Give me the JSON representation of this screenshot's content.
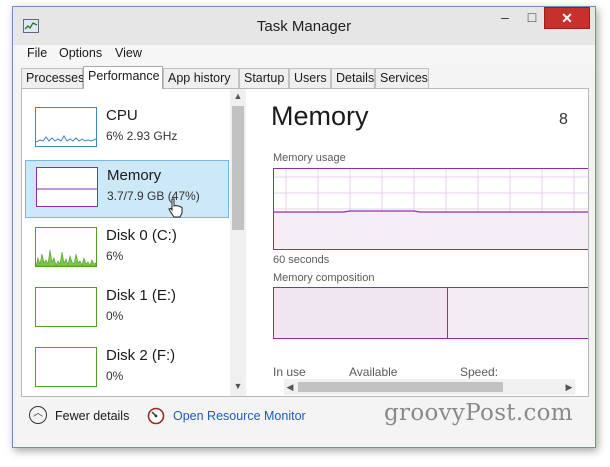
{
  "window": {
    "title": "Task Manager",
    "controls": {
      "minimize": "–",
      "maximize": "□",
      "close": "✕"
    }
  },
  "menu": {
    "file": "File",
    "options": "Options",
    "view": "View"
  },
  "tabs": [
    {
      "label": "Processes"
    },
    {
      "label": "Performance"
    },
    {
      "label": "App history"
    },
    {
      "label": "Startup"
    },
    {
      "label": "Users"
    },
    {
      "label": "Details"
    },
    {
      "label": "Services"
    }
  ],
  "active_tab": "Performance",
  "resources": [
    {
      "name": "CPU",
      "value": "6% 2.93 GHz",
      "color": "#3d87c4"
    },
    {
      "name": "Memory",
      "value": "3.7/7.9 GB (47%)",
      "color": "#8b2fa3"
    },
    {
      "name": "Disk 0 (C:)",
      "value": "6%",
      "color": "#4da023"
    },
    {
      "name": "Disk 1 (E:)",
      "value": "0%",
      "color": "#4da023"
    },
    {
      "name": "Disk 2 (F:)",
      "value": "0%",
      "color": "#4da023"
    }
  ],
  "detail": {
    "title": "Memory",
    "capacity_fragment": "8",
    "usage_label": "Memory usage",
    "time_label": "60 seconds",
    "composition_label": "Memory composition",
    "stats": {
      "in_use": "In use",
      "available": "Available",
      "speed": "Speed:"
    }
  },
  "footer": {
    "fewer_details": "Fewer details",
    "open_monitor": "Open Resource Monitor"
  },
  "watermark": "groovyPost.com"
}
